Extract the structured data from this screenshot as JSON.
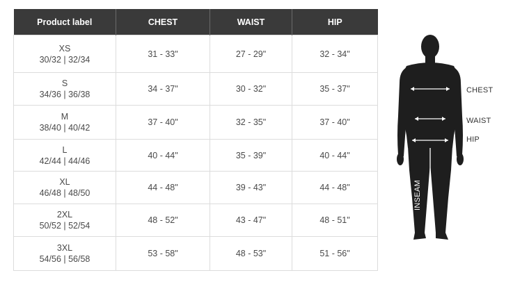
{
  "table": {
    "headers": [
      "Product label",
      "CHEST",
      "WAIST",
      "HIP"
    ],
    "rows": [
      {
        "size": "XS",
        "numeric": "30/32 | 32/34",
        "chest": "31 - 33\"",
        "waist": "27 - 29\"",
        "hip": "32 - 34\""
      },
      {
        "size": "S",
        "numeric": "34/36 | 36/38",
        "chest": "34 - 37\"",
        "waist": "30 - 32\"",
        "hip": "35 - 37\""
      },
      {
        "size": "M",
        "numeric": "38/40 | 40/42",
        "chest": "37 - 40\"",
        "waist": "32 - 35\"",
        "hip": "37 - 40\""
      },
      {
        "size": "L",
        "numeric": "42/44 | 44/46",
        "chest": "40 - 44\"",
        "waist": "35 - 39\"",
        "hip": "40 - 44\""
      },
      {
        "size": "XL",
        "numeric": "46/48 | 48/50",
        "chest": "44 - 48\"",
        "waist": "39 - 43\"",
        "hip": "44 - 48\""
      },
      {
        "size": "2XL",
        "numeric": "50/52 | 52/54",
        "chest": "48 - 52\"",
        "waist": "43 - 47\"",
        "hip": "48 - 51\""
      },
      {
        "size": "3XL",
        "numeric": "54/56 | 56/58",
        "chest": "53 - 58\"",
        "waist": "48 - 53\"",
        "hip": "51 - 56\""
      }
    ]
  },
  "figure": {
    "labels": {
      "chest": "CHEST",
      "waist": "WAIST",
      "hip": "HIP",
      "inseam": "INSEAM"
    },
    "colors": {
      "silhouette": "#1e1e1e",
      "measure_lines": "#ffffff"
    }
  }
}
